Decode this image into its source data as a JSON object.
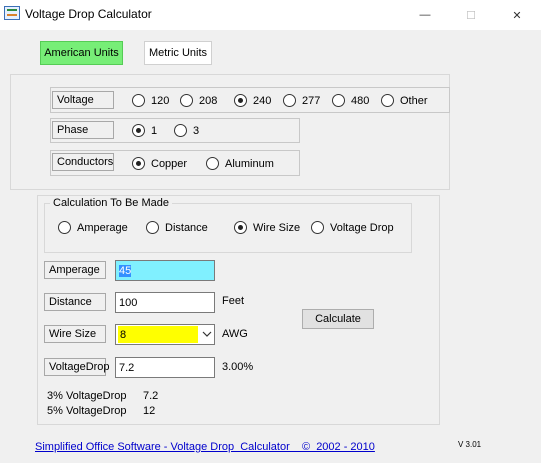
{
  "window": {
    "title": "Voltage Drop Calculator",
    "minimize": "—",
    "maximize": "☐",
    "close": "✕"
  },
  "units": {
    "american": "American Units",
    "metric": "Metric Units"
  },
  "voltage": {
    "label": "Voltage",
    "options": [
      "120",
      "208",
      "240",
      "277",
      "480",
      "Other"
    ],
    "selected": "240"
  },
  "phase": {
    "label": "Phase",
    "options": [
      "1",
      "3"
    ],
    "selected": "1"
  },
  "conductors": {
    "label": "Conductors",
    "options": [
      "Copper",
      "Aluminum"
    ],
    "selected": "Copper"
  },
  "calculation": {
    "legend": "Calculation To Be Made",
    "options": [
      "Amperage",
      "Distance",
      "Wire Size",
      "Voltage Drop"
    ],
    "selected": "Wire Size"
  },
  "inputs": {
    "amperage": {
      "label": "Amperage",
      "value": "45"
    },
    "distance": {
      "label": "Distance",
      "value": "100",
      "unit": "Feet"
    },
    "wire_size": {
      "label": "Wire Size",
      "value": "8",
      "unit": "AWG"
    },
    "voltage_drop": {
      "label": "VoltageDrop",
      "value": "7.2",
      "percent": "3.00%"
    }
  },
  "calculate_button": "Calculate",
  "results": [
    {
      "label": "3% VoltageDrop",
      "value": "7.2"
    },
    {
      "label": "5% VoltageDrop",
      "value": "12"
    }
  ],
  "footer": {
    "link": "Simplified Office Software - Voltage Drop  Calculator    ©  2002 - 2010",
    "version": "V 3.01"
  },
  "colors": {
    "american_tab": "#77ee77",
    "amperage_field": "#80f0ff",
    "wire_size_field": "#ffff00",
    "link": "#0000cc"
  }
}
